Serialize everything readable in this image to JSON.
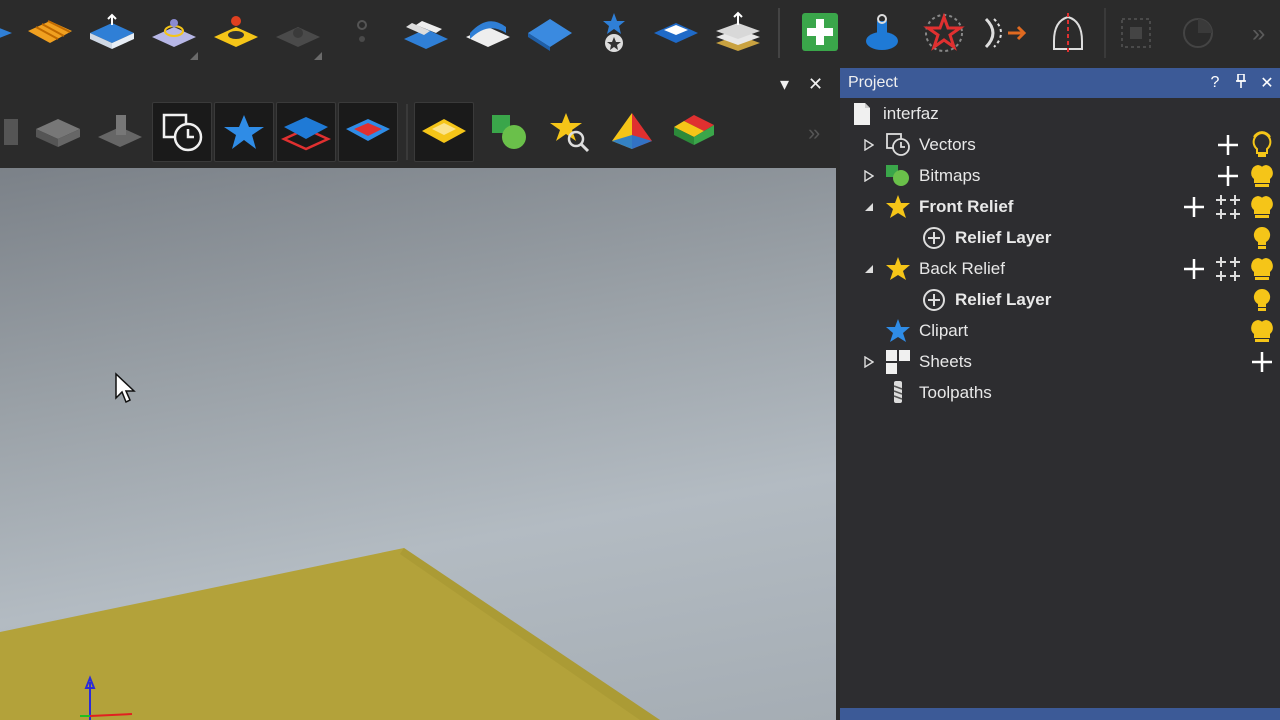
{
  "project_panel": {
    "title": "Project",
    "help": "?",
    "pin": "↓",
    "close": "✕"
  },
  "second_toolbar": {
    "menu_arrow": "▾",
    "close": "✕",
    "overflow": "»"
  },
  "top_toolbar": {
    "overflow": "»"
  },
  "tree": {
    "root": "interfaz",
    "items": [
      {
        "label": "Vectors",
        "bold": false
      },
      {
        "label": "Bitmaps",
        "bold": false
      },
      {
        "label": "Front Relief",
        "bold": true
      },
      {
        "label": "Relief Layer",
        "bold": true
      },
      {
        "label": "Back Relief",
        "bold": false
      },
      {
        "label": "Relief Layer",
        "bold": true
      },
      {
        "label": "Clipart",
        "bold": false
      },
      {
        "label": "Sheets",
        "bold": false
      },
      {
        "label": "Toolpaths",
        "bold": false
      }
    ]
  },
  "colors": {
    "panel_header": "#3c5a97",
    "accent_yellow": "#f5c518",
    "relief_plane": "#b3a23a",
    "green_add": "#3aa64a"
  }
}
